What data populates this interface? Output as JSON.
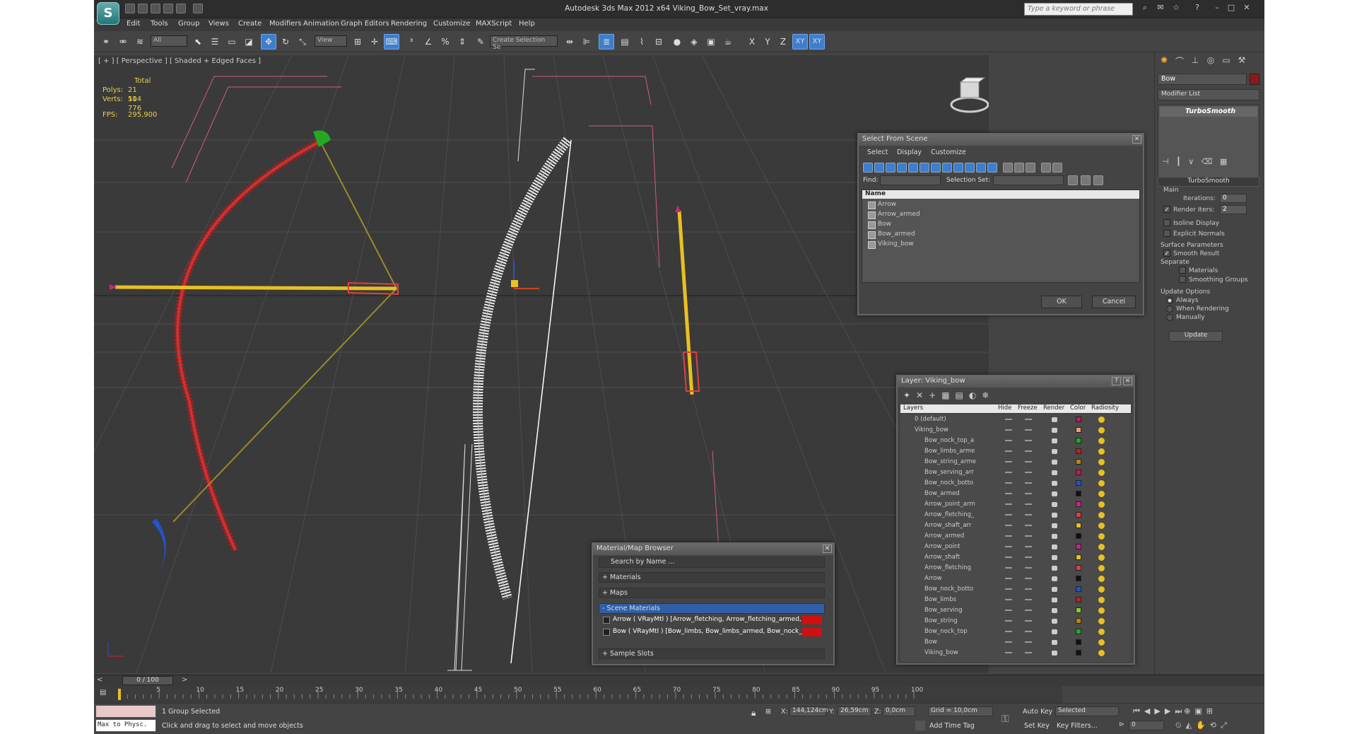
{
  "app": {
    "logo": "S",
    "title": "Autodesk 3ds Max  2012 x64      Viking_Bow_Set_vray.max",
    "search_placeholder": "Type a keyword or phrase"
  },
  "menu": [
    "Edit",
    "Tools",
    "Group",
    "Views",
    "Create",
    "Modifiers",
    "Animation",
    "Graph Editors",
    "Rendering",
    "Customize",
    "MAXScript",
    "Help"
  ],
  "toolbar": {
    "filter_value": "All",
    "refcoord_value": "View",
    "selection_set_placeholder": "Create Selection Se",
    "axis_labels": [
      "X",
      "Y",
      "Z",
      "XY",
      "XY"
    ]
  },
  "viewport": {
    "label": "[ + ] [ Perspective ] [ Shaded + Edged Faces ]",
    "stats": {
      "total_label": "Total",
      "polys_label": "Polys:",
      "polys_value": "21 504",
      "verts_label": "Verts:",
      "verts_value": "11 776",
      "fps_label": "FPS:",
      "fps_value": "295,900"
    }
  },
  "command_panel": {
    "object_name": "Bow",
    "object_color": "#8b1a1a",
    "modifier_list": "Modifier List",
    "stack_item": "TurboSmooth",
    "rollout_title": "TurboSmooth",
    "main_label": "Main",
    "iterations_label": "Iterations:",
    "iterations_value": "0",
    "render_iters_label": "Render Iters:",
    "render_iters_value": "2",
    "isoline_label": "Isoline Display",
    "explicit_normals_label": "Explicit Normals",
    "surface_params_label": "Surface Parameters",
    "smooth_result_label": "Smooth Result",
    "separate_label": "Separate",
    "materials_label": "Materials",
    "smoothing_groups_label": "Smoothing Groups",
    "update_options_label": "Update Options",
    "always_label": "Always",
    "when_rendering_label": "When Rendering",
    "manually_label": "Manually",
    "update_button": "Update"
  },
  "select_from_scene": {
    "title": "Select From Scene",
    "menu": [
      "Select",
      "Display",
      "Customize"
    ],
    "find_label": "Find:",
    "selection_set_label": "Selection Set:",
    "column_name": "Name",
    "items": [
      "Arrow",
      "Arrow_armed",
      "Bow",
      "Bow_armed",
      "Viking_bow"
    ],
    "ok": "OK",
    "cancel": "Cancel"
  },
  "layer_manager": {
    "title": "Layer: Viking_bow",
    "help": "?",
    "columns": [
      "Layers",
      "Hide",
      "Freeze",
      "Render",
      "Color",
      "Radiosity"
    ],
    "rows": [
      {
        "name": "0 (default)",
        "color": "#c2185b"
      },
      {
        "name": "Viking_bow",
        "color": "#e8a070"
      },
      {
        "name": "Bow_nock_top_a",
        "color": "#22aa22"
      },
      {
        "name": "Bow_limbs_arme",
        "color": "#c02020"
      },
      {
        "name": "Bow_string_arme",
        "color": "#b8860b"
      },
      {
        "name": "Bow_serving_arr",
        "color": "#c2185b"
      },
      {
        "name": "Bow_nock_botto",
        "color": "#2255cc"
      },
      {
        "name": "Bow_armed",
        "color": "#111111"
      },
      {
        "name": "Arrow_point_arm",
        "color": "#cc2288"
      },
      {
        "name": "Arrow_fletching_",
        "color": "#e04040"
      },
      {
        "name": "Arrow_shaft_arr",
        "color": "#e8c020"
      },
      {
        "name": "Arrow_armed",
        "color": "#111111"
      },
      {
        "name": "Arrow_point",
        "color": "#cc2288"
      },
      {
        "name": "Arrow_shaft",
        "color": "#e8c020"
      },
      {
        "name": "Arrow_fletching",
        "color": "#e04040"
      },
      {
        "name": "Arrow",
        "color": "#111111"
      },
      {
        "name": "Bow_nock_botto",
        "color": "#2255cc"
      },
      {
        "name": "Bow_limbs",
        "color": "#c02020"
      },
      {
        "name": "Bow_serving",
        "color": "#88cc22"
      },
      {
        "name": "Bow_string",
        "color": "#b8860b"
      },
      {
        "name": "Bow_nock_top",
        "color": "#22aa22"
      },
      {
        "name": "Bow",
        "color": "#111111"
      },
      {
        "name": "Viking_bow",
        "color": "#111111"
      }
    ]
  },
  "material_browser": {
    "title": "Material/Map Browser",
    "search_placeholder": "Search by Name ...",
    "sections": [
      "+ Materials",
      "+ Maps",
      "- Scene Materials",
      "+ Sample Slots"
    ],
    "scene_materials": [
      "Arrow  ( VRayMtl ) [Arrow_fletching, Arrow_fletching_armed, Arrow_point, Arro...",
      "Bow  ( VRayMtl ) [Bow_limbs, Bow_limbs_armed, Bow_nock_bottom, Bow_nock..."
    ]
  },
  "timeline": {
    "frame_label": "0 / 100",
    "ticks": [
      "5",
      "10",
      "15",
      "20",
      "25",
      "30",
      "35",
      "40",
      "45",
      "50",
      "55",
      "60",
      "65",
      "70",
      "75",
      "80",
      "85",
      "90",
      "95",
      "100"
    ]
  },
  "status": {
    "script_box": "Max to Physc.",
    "selection": "1 Group Selected",
    "prompt": "Click and drag to select and move objects",
    "x_label": "X:",
    "x_value": "144,124cm",
    "y_label": "Y:",
    "y_value": "26,59cm",
    "z_label": "Z:",
    "z_value": "0,0cm",
    "grid": "Grid = 10,0cm",
    "add_time_tag": "Add Time Tag",
    "auto_key": "Auto Key",
    "selected": "Selected",
    "set_key": "Set Key",
    "key_filters": "Key Filters...",
    "frame_value": "0"
  }
}
